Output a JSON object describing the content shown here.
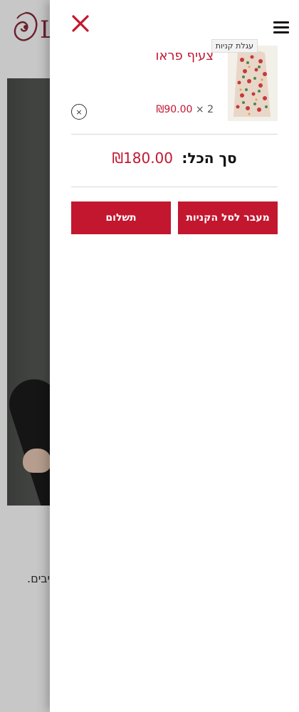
{
  "background": {
    "logo_text": "L",
    "body_text": "יבים."
  },
  "drawer": {
    "close_icon": "close-icon",
    "tooltip": "עגלת קניות",
    "item": {
      "name": "צעיף פראו",
      "quantity": "2",
      "multiplier": "×",
      "unit_price": "₪90.00",
      "remove_icon": "remove-circle-icon",
      "remove_symbol": "×"
    },
    "total": {
      "label": "סך הכל:",
      "value": "₪180.00"
    },
    "buttons": {
      "view_cart": "מעבר לסל הקניות",
      "checkout": "תשלום"
    }
  },
  "colors": {
    "accent": "#c2172f",
    "logo": "#8a2b3a"
  }
}
